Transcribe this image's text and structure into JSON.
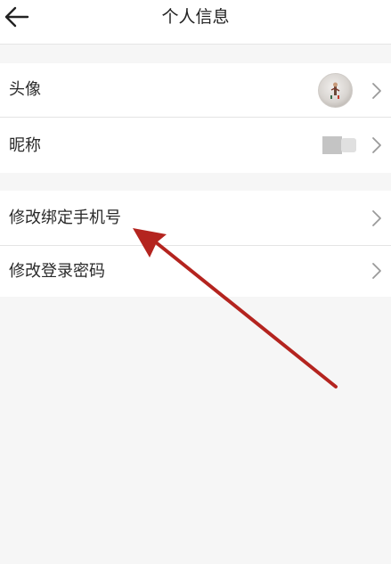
{
  "header": {
    "title": "个人信息"
  },
  "profile_group": {
    "items": [
      {
        "label": "头像"
      },
      {
        "label": "昵称"
      }
    ]
  },
  "account_group": {
    "items": [
      {
        "label": "修改绑定手机号"
      },
      {
        "label": "修改登录密码"
      }
    ]
  },
  "annotation": {
    "color": "#b4241f"
  },
  "icons": {
    "back": "arrow-left-icon",
    "chevron": "chevron-right-icon"
  }
}
